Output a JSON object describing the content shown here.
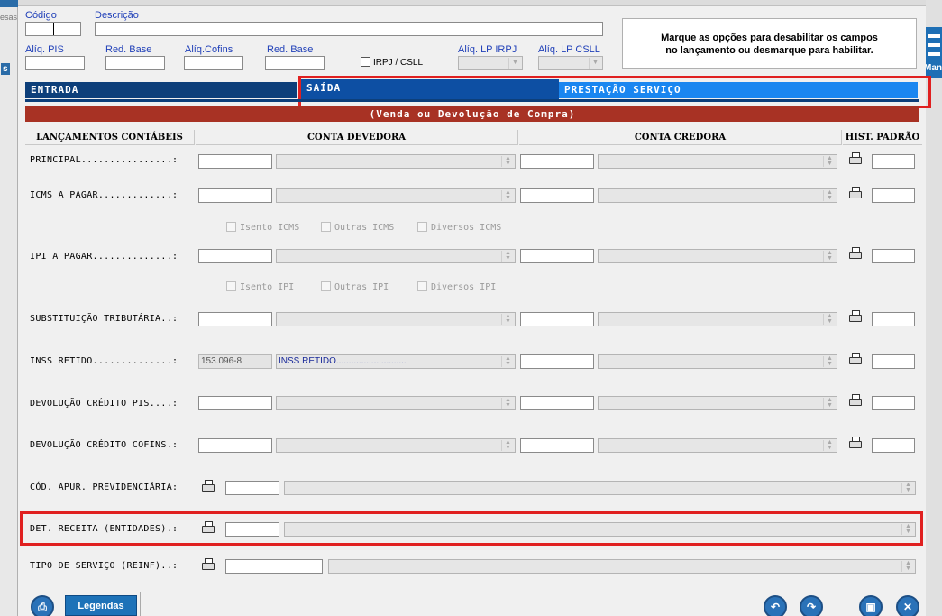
{
  "header": {
    "codigo_label": "Código",
    "descricao_label": "Descrição",
    "aliq_pis_label": "Alíq. PIS",
    "red_base_1_label": "Red. Base",
    "aliq_cofins_label": "Alíq.Cofins",
    "red_base_2_label": "Red. Base",
    "irpj_csll_label": "IRPJ / CSLL",
    "aliq_lp_irpj_label": "Alíq. LP IRPJ",
    "aliq_lp_csll_label": "Alíq. LP CSLL",
    "info_line1": "Marque as opções para desabilitar os campos",
    "info_line2": "no lançamento ou desmarque para habilitar."
  },
  "tabs": [
    {
      "label": "ENTRADA"
    },
    {
      "label": "SAÍDA"
    },
    {
      "label": "PRESTAÇÃO SERVIÇO"
    }
  ],
  "banner": "(Venda ou Devolução de Compra)",
  "columns": {
    "lancamentos": "LANÇAMENTOS CONTÁBEIS",
    "devedora": "CONTA DEVEDORA",
    "credora": "CONTA CREDORA",
    "hist": "HIST. PADRÃO"
  },
  "rows": [
    {
      "label": "PRINCIPAL................:",
      "dev_code": "",
      "dev_desc": ""
    },
    {
      "label": "ICMS A PAGAR.............:",
      "dev_code": "",
      "dev_desc": ""
    },
    {
      "label": "IPI A PAGAR..............:",
      "dev_code": "",
      "dev_desc": ""
    },
    {
      "label": "SUBSTITUIÇÃO TRIBUTÁRIA..:",
      "dev_code": "",
      "dev_desc": ""
    },
    {
      "label": "INSS RETIDO..............:",
      "dev_code": "153.096-8",
      "dev_desc": "INSS RETIDO............................"
    },
    {
      "label": "DEVOLUÇÃO CRÉDITO PIS....:",
      "dev_code": "",
      "dev_desc": ""
    },
    {
      "label": "DEVOLUÇÃO CRÉDITO COFINS.:",
      "dev_code": "",
      "dev_desc": ""
    }
  ],
  "icms_checks": [
    "Isento ICMS",
    "Outras ICMS",
    "Diversos ICMS"
  ],
  "ipi_checks": [
    "Isento IPI",
    "Outras IPI",
    "Diversos IPI"
  ],
  "extra_rows": [
    {
      "label": "CÓD. APUR. PREVIDENCIÁRIA:"
    },
    {
      "label": "DET. RECEITA (ENTIDADES).:"
    },
    {
      "label": "TIPO DE SERVIÇO (REINF)..:"
    }
  ],
  "footer": {
    "legendas_label": "Legendas"
  },
  "edge": {
    "left_top": "esas",
    "left_blue": "s",
    "right_label": "Man"
  }
}
